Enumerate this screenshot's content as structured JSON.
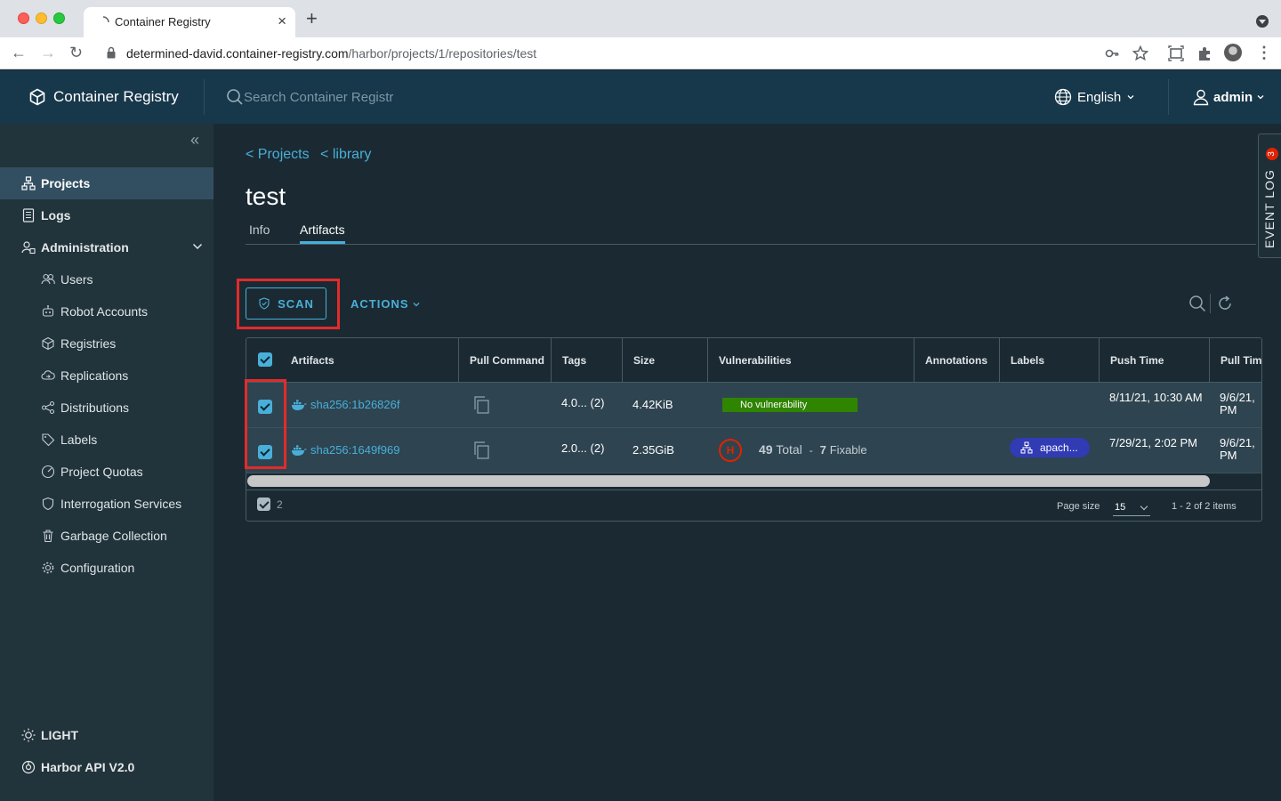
{
  "browser": {
    "tab_title": "Container Registry",
    "url_host": "determined-david.container-registry.com",
    "url_path": "/harbor/projects/1/repositories/test"
  },
  "header": {
    "app_title": "Container Registry",
    "search_placeholder": "Search Container Registr",
    "language": "English",
    "user": "admin"
  },
  "sidebar": {
    "items": [
      {
        "label": "Projects",
        "icon": "projects-icon",
        "active": true
      },
      {
        "label": "Logs",
        "icon": "logs-icon"
      },
      {
        "label": "Administration",
        "icon": "administration-icon"
      }
    ],
    "admin_items": [
      {
        "label": "Users",
        "icon": "users-icon"
      },
      {
        "label": "Robot Accounts",
        "icon": "robot-icon"
      },
      {
        "label": "Registries",
        "icon": "registries-icon"
      },
      {
        "label": "Replications",
        "icon": "replications-icon"
      },
      {
        "label": "Distributions",
        "icon": "distributions-icon"
      },
      {
        "label": "Labels",
        "icon": "tag-icon"
      },
      {
        "label": "Project Quotas",
        "icon": "quota-icon"
      },
      {
        "label": "Interrogation Services",
        "icon": "shield-icon"
      },
      {
        "label": "Garbage Collection",
        "icon": "trash-icon"
      },
      {
        "label": "Configuration",
        "icon": "gear-icon"
      }
    ],
    "theme_label": "LIGHT",
    "api_label": "Harbor API V2.0"
  },
  "main": {
    "breadcrumb": [
      "< Projects",
      "< library"
    ],
    "title": "test",
    "tabs": [
      {
        "label": "Info",
        "active": false
      },
      {
        "label": "Artifacts",
        "active": true
      }
    ],
    "event_log": {
      "label": "EVENT LOG",
      "count": "3"
    },
    "scan_label": "SCAN",
    "actions_label": "ACTIONS",
    "columns": [
      "Artifacts",
      "Pull Command",
      "Tags",
      "Size",
      "Vulnerabilities",
      "Annotations",
      "Labels",
      "Push Time",
      "Pull Time"
    ],
    "rows": [
      {
        "digest": "sha256:1b26826f",
        "tags": "4.0... (2)",
        "size": "4.42KiB",
        "vuln_text": "No vulnerability",
        "label": "",
        "push_time": "8/11/21, 10:30 AM",
        "pull_time": "9/6/21, PM",
        "checked": true
      },
      {
        "digest": "sha256:1649f969",
        "tags": "2.0... (2)",
        "size": "2.35GiB",
        "severity": "H",
        "total_count": "49",
        "total_label": "Total",
        "separator": "-",
        "fixable_count": "7",
        "fixable_label": "Fixable",
        "label": "apach...",
        "push_time": "7/29/21, 2:02 PM",
        "pull_time": "9/6/21, PM",
        "checked": true
      }
    ],
    "footer": {
      "selected_count": "2",
      "page_size_label": "Page size",
      "page_size": "15",
      "range": "1 - 2 of 2 items"
    },
    "colors": {
      "accent": "#49afd9",
      "highlight": "#e22b2b",
      "no_vuln": "#2f8400",
      "critical": "#e12200",
      "label_pill": "#303bb4"
    }
  }
}
